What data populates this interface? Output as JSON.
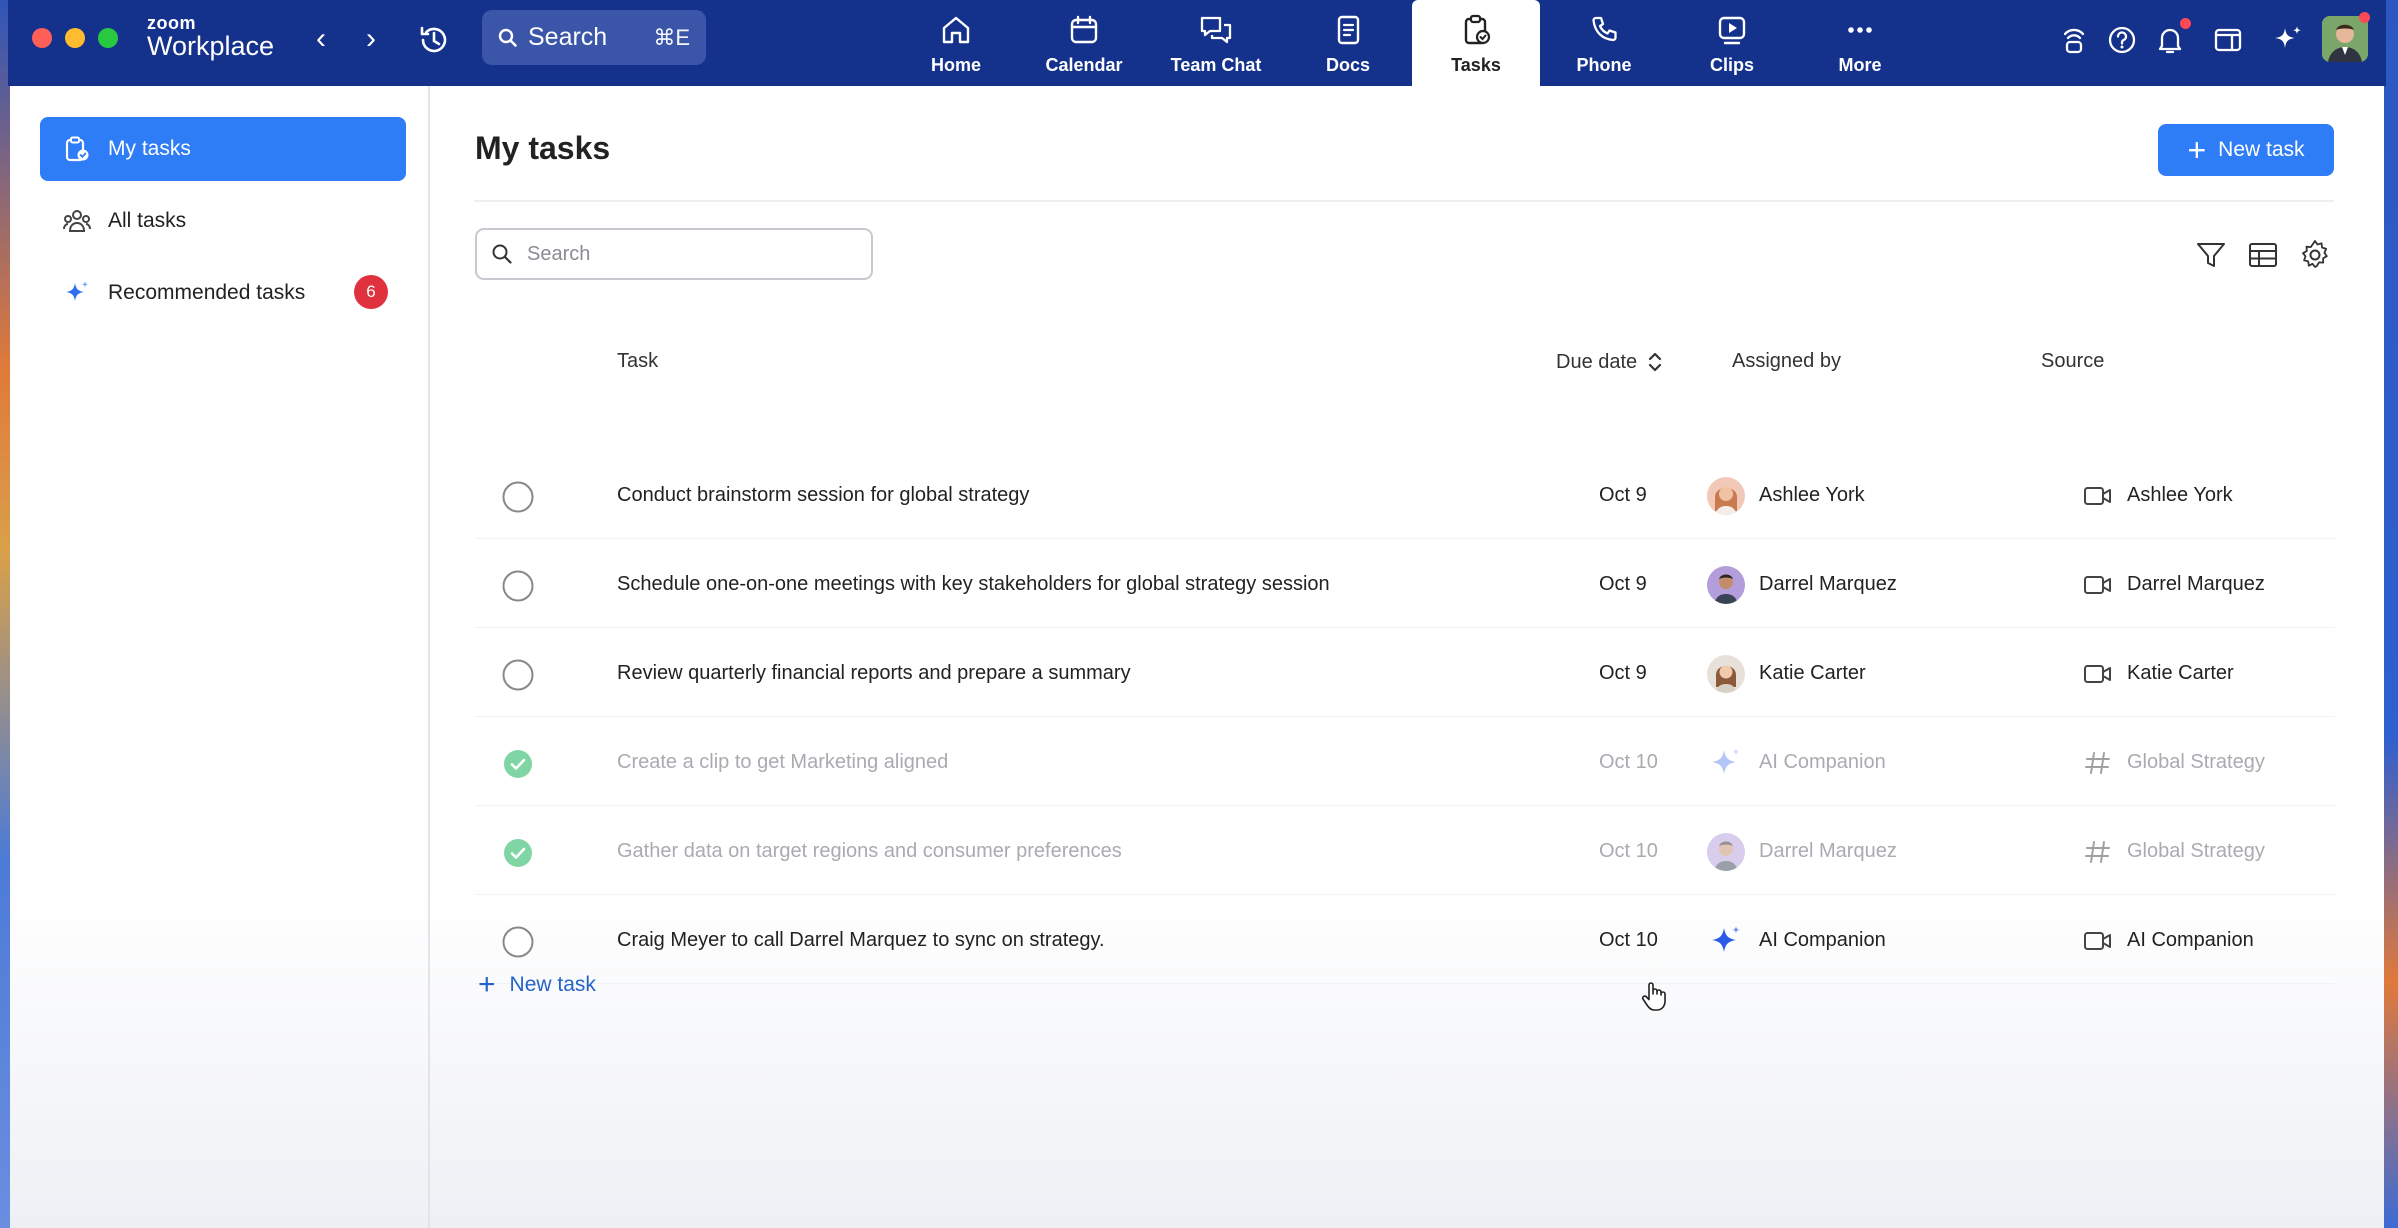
{
  "app": {
    "logo_line1": "zoom",
    "logo_line2": "Workplace"
  },
  "topbar": {
    "search_label": "Search",
    "search_shortcut": "⌘E",
    "tabs": [
      {
        "label": "Home",
        "icon": "home-icon"
      },
      {
        "label": "Calendar",
        "icon": "calendar-icon"
      },
      {
        "label": "Team Chat",
        "icon": "chat-icon"
      },
      {
        "label": "Docs",
        "icon": "docs-icon"
      },
      {
        "label": "Tasks",
        "icon": "tasks-icon",
        "active": true
      },
      {
        "label": "Phone",
        "icon": "phone-icon"
      },
      {
        "label": "Clips",
        "icon": "clips-icon"
      },
      {
        "label": "More",
        "icon": "more-icon"
      }
    ]
  },
  "sidebar": {
    "items": [
      {
        "label": "My tasks",
        "icon": "my-tasks-icon",
        "active": true
      },
      {
        "label": "All tasks",
        "icon": "team-icon"
      },
      {
        "label": "Recommended tasks",
        "icon": "sparkle-icon",
        "badge": "6"
      }
    ]
  },
  "main": {
    "title": "My tasks",
    "new_task_button": "New task",
    "search_placeholder": "Search",
    "columns": {
      "task": "Task",
      "due": "Due date",
      "assigned": "Assigned by",
      "source": "Source"
    },
    "rows": [
      {
        "task": "Conduct brainstorm session for global strategy",
        "due": "Oct 9",
        "assigned_by": "Ashlee York",
        "source": "Ashlee York",
        "source_icon": "video-icon",
        "done": false
      },
      {
        "task": "Schedule one-on-one meetings with key stakeholders for global strategy session",
        "due": "Oct 9",
        "assigned_by": "Darrel Marquez",
        "source": "Darrel Marquez",
        "source_icon": "video-icon",
        "done": false
      },
      {
        "task": "Review quarterly financial reports and prepare a summary",
        "due": "Oct 9",
        "assigned_by": "Katie Carter",
        "source": "Katie Carter",
        "source_icon": "video-icon",
        "done": false
      },
      {
        "task": "Create a clip to get Marketing aligned",
        "due": "Oct 10",
        "assigned_by": "AI Companion",
        "source": "Global Strategy",
        "source_icon": "hashtag-icon",
        "done": true
      },
      {
        "task": "Gather data on target regions and consumer preferences",
        "due": "Oct 10",
        "assigned_by": "Darrel Marquez",
        "source": "Global Strategy",
        "source_icon": "hashtag-icon",
        "done": true
      },
      {
        "task": "Craig Meyer to call Darrel Marquez to sync on strategy.",
        "due": "Oct 10",
        "assigned_by": "AI Companion",
        "source": "AI Companion",
        "source_icon": "video-icon",
        "done": false
      }
    ],
    "add_task_label": "New task"
  },
  "colors": {
    "topbar": "#14328c",
    "accent": "#2e7cf6",
    "badge": "#e0313f",
    "done_check": "#3cc07a"
  }
}
